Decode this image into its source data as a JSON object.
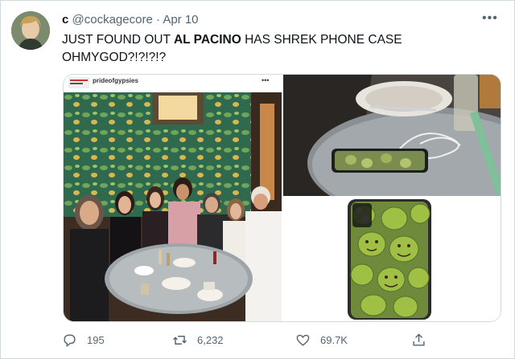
{
  "tweet": {
    "author_name": "c",
    "handle": "@cockagecore",
    "separator": "·",
    "date": "Apr 10",
    "text_part1": "JUST FOUND OUT ",
    "text_bold": "AL PACINO",
    "text_part2": " HAS SHREK PHONE CASE OHMYGOD?!?!?!?"
  },
  "media": {
    "instagram_username": "prideofgypsies",
    "instagram_more": "•••"
  },
  "actions": {
    "replies": "195",
    "retweets": "6,232",
    "likes": "69.7K"
  },
  "icons": {
    "more": "more-icon",
    "reply": "reply-icon",
    "retweet": "retweet-icon",
    "like": "heart-icon",
    "share": "share-icon"
  },
  "colors": {
    "text": "#0f1419",
    "secondary": "#536471",
    "border": "#cfd9de",
    "shrek_green": "#8db03c"
  }
}
